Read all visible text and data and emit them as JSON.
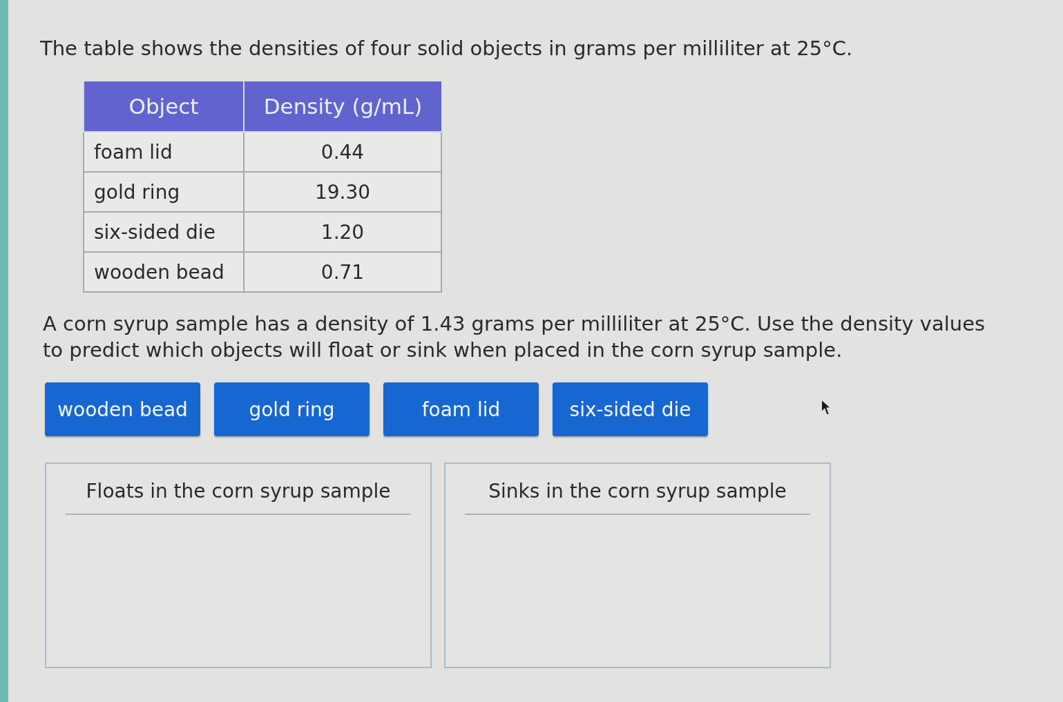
{
  "intro": "The table shows the densities of four solid objects in grams per milliliter at 25°C.",
  "table": {
    "columns": [
      "Object",
      "Density (g/mL)"
    ],
    "rows": [
      [
        "foam lid",
        "0.44"
      ],
      [
        "gold ring",
        "19.30"
      ],
      [
        "six-sided die",
        "1.20"
      ],
      [
        "wooden bead",
        "0.71"
      ]
    ]
  },
  "prompt": "A corn syrup sample has a density of 1.43 grams per milliliter at 25°C. Use the density values to predict which objects will float or sink when placed in the corn syrup sample.",
  "tiles": [
    "wooden bead",
    "gold ring",
    "foam lid",
    "six-sided die"
  ],
  "drop_zones": [
    {
      "title": "Floats in the corn syrup sample"
    },
    {
      "title": "Sinks in the corn syrup sample"
    }
  ]
}
